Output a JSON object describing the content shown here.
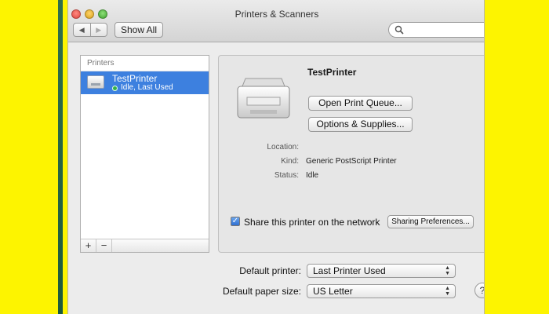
{
  "window": {
    "title": "Printers & Scanners",
    "show_all": "Show All",
    "back_glyph": "◀",
    "forward_glyph": "▶"
  },
  "sidebar": {
    "header": "Printers",
    "items": [
      {
        "name": "TestPrinter",
        "status": "Idle, Last Used",
        "selected": true
      }
    ],
    "add_glyph": "+",
    "remove_glyph": "−"
  },
  "detail": {
    "printer_name": "TestPrinter",
    "open_queue_label": "Open Print Queue...",
    "options_label": "Options & Supplies...",
    "location_label": "Location:",
    "location_value": "",
    "kind_label": "Kind:",
    "kind_value": "Generic PostScript Printer",
    "status_label": "Status:",
    "status_value": "Idle",
    "share_checked": true,
    "share_check_glyph": "✓",
    "share_label": "Share this printer on the network",
    "sharing_prefs_label": "Sharing Preferences..."
  },
  "footer": {
    "default_printer_label": "Default printer:",
    "default_printer_value": "Last Printer Used",
    "paper_size_label": "Default paper size:",
    "paper_size_value": "US Letter",
    "help_glyph": "?"
  },
  "colors": {
    "selection": "#3d80df",
    "background_yellow": "#fdf400",
    "status_green": "#34b04a"
  },
  "icons": [
    "search-icon",
    "printer-icon",
    "status-dot-icon"
  ]
}
